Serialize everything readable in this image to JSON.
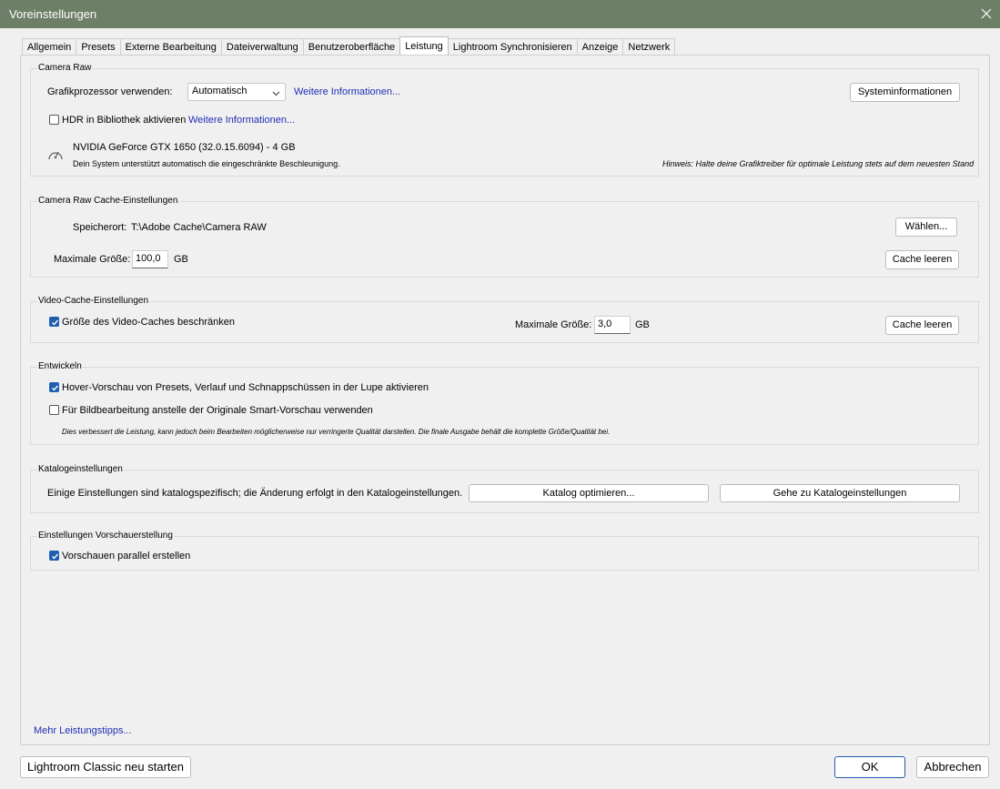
{
  "window": {
    "title": "Voreinstellungen"
  },
  "tabs": [
    {
      "label": "Allgemein"
    },
    {
      "label": "Presets"
    },
    {
      "label": "Externe Bearbeitung"
    },
    {
      "label": "Dateiverwaltung"
    },
    {
      "label": "Benutzeroberfläche"
    },
    {
      "label": "Leistung",
      "active": true
    },
    {
      "label": "Lightroom Synchronisieren"
    },
    {
      "label": "Anzeige"
    },
    {
      "label": "Netzwerk"
    }
  ],
  "camera_raw": {
    "title": "Camera Raw",
    "gpu_label": "Grafikprozessor verwenden:",
    "gpu_value": "Automatisch",
    "more_info_1": "Weitere Informationen...",
    "sysinfo_button": "Systeminformationen",
    "hdr_label": "HDR in Bibliothek aktivieren",
    "hdr_checked": false,
    "more_info_2": "Weitere Informationen...",
    "gpu_name": "NVIDIA GeForce GTX 1650 (32.0.15.6094) - 4 GB",
    "gpu_status": "Dein System unterstützt automatisch die eingeschränkte Beschleunigung.",
    "hint": "Hinweis: Halte deine Grafiktreiber für optimale Leistung stets auf dem neuesten Stand"
  },
  "cache": {
    "title": "Camera Raw Cache-Einstellungen",
    "location_label": "Speicherort:",
    "location_value": "T:\\Adobe Cache\\Camera RAW",
    "choose_button": "Wählen...",
    "max_size_label": "Maximale Größe:",
    "max_size_value": "100,0",
    "unit": "GB",
    "clear_button": "Cache leeren"
  },
  "video_cache": {
    "title": "Video-Cache-Einstellungen",
    "limit_label": "Größe des Video-Caches beschränken",
    "limit_checked": true,
    "max_size_label": "Maximale Größe:",
    "max_size_value": "3,0",
    "unit": "GB",
    "clear_button": "Cache leeren"
  },
  "develop": {
    "title": "Entwickeln",
    "hover_label": "Hover-Vorschau von Presets, Verlauf und Schnappschüssen in der Lupe aktivieren",
    "hover_checked": true,
    "smart_label": "Für Bildbearbeitung anstelle der Originale Smart-Vorschau verwenden",
    "smart_checked": false,
    "note": "Dies verbessert die Leistung, kann jedoch beim Bearbeiten möglicherweise nur verringerte Qualität darstellen. Die finale Ausgabe behält die komplette Größe/Qualität bei."
  },
  "catalog": {
    "title": "Katalogeinstellungen",
    "text": "Einige Einstellungen sind katalogspezifisch; die Änderung erfolgt in den Katalogeinstellungen.",
    "optimize_button": "Katalog optimieren...",
    "goto_button": "Gehe zu Katalogeinstellungen"
  },
  "preview": {
    "title": "Einstellungen Vorschauerstellung",
    "parallel_label": "Vorschauen parallel erstellen",
    "parallel_checked": true
  },
  "more_tips": "Mehr Leistungstipps...",
  "footer": {
    "restart_button": "Lightroom Classic neu starten",
    "ok_button": "OK",
    "cancel_button": "Abbrechen"
  },
  "colors": {
    "titlebar": "#6d7f66",
    "link": "#1f2fb5",
    "checkbox_checked": "#1f5fb0"
  }
}
